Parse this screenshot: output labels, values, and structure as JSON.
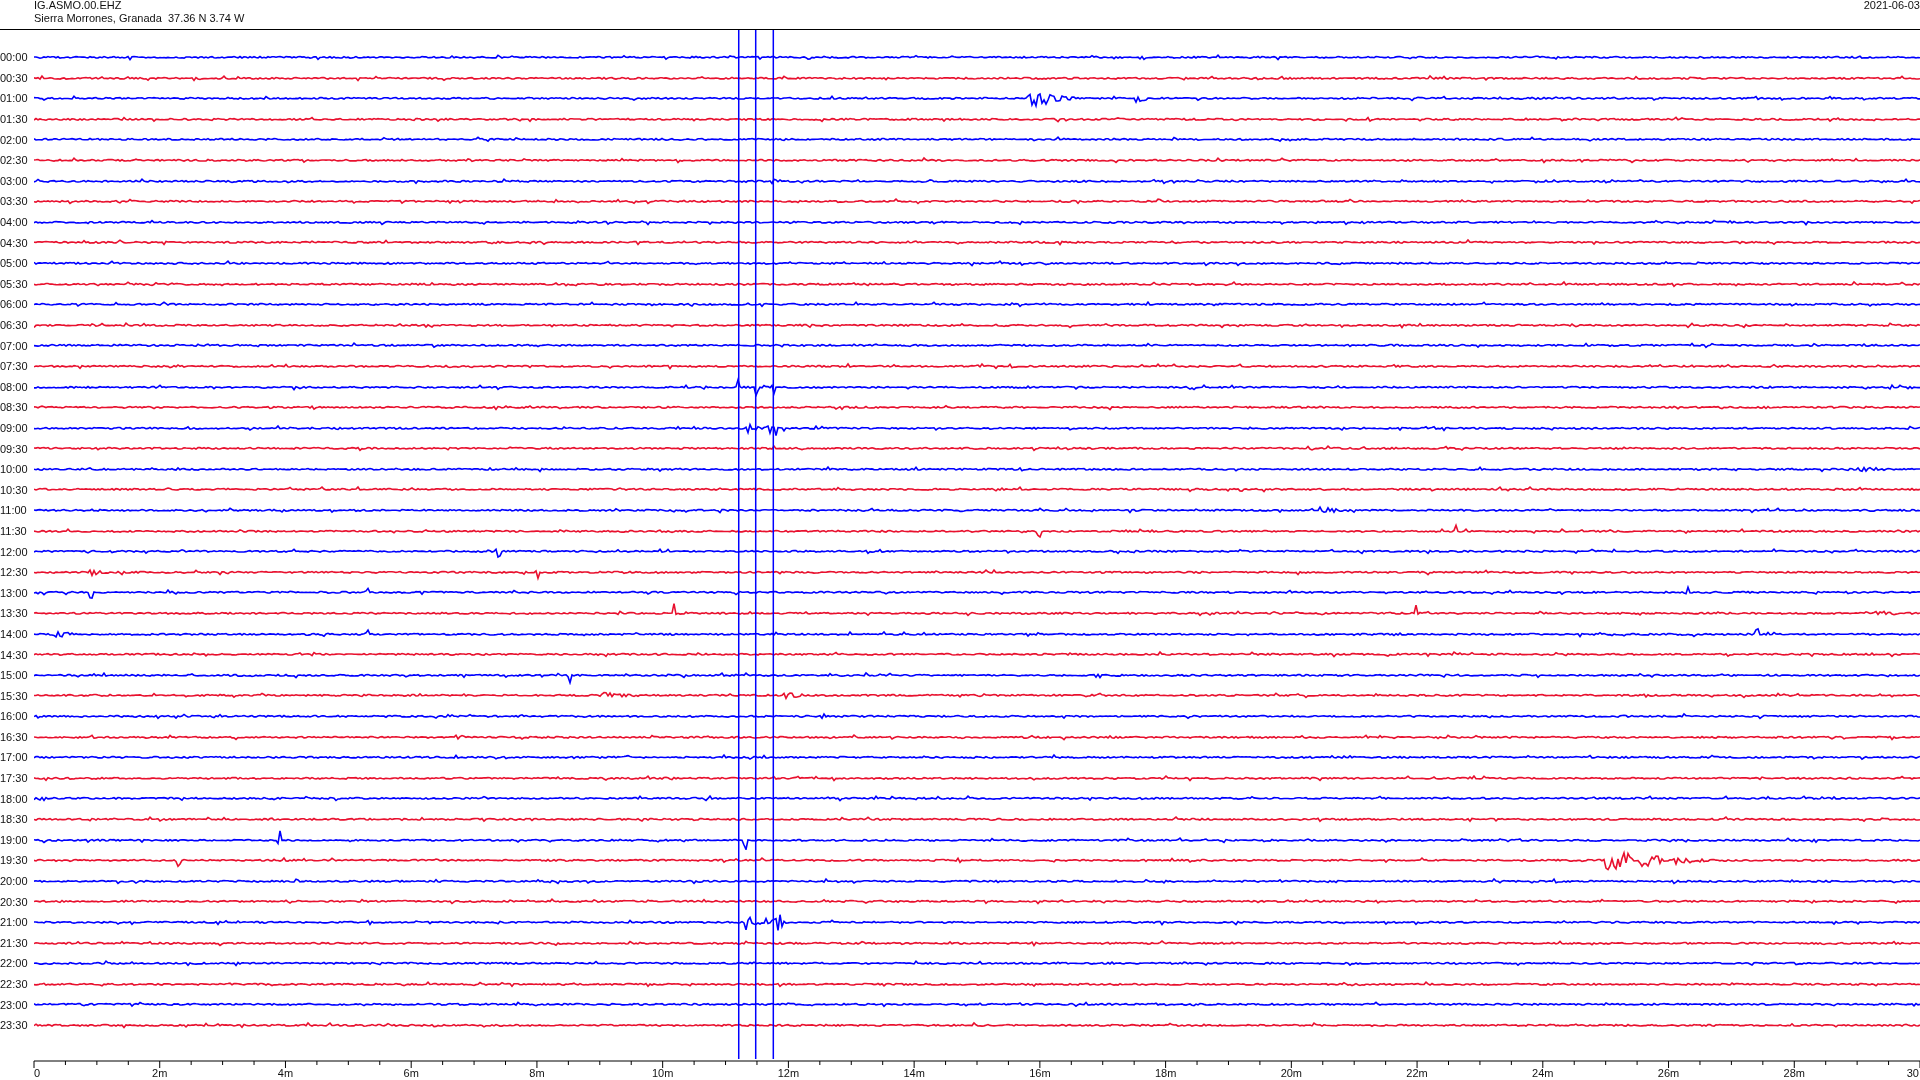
{
  "header": {
    "station": "IG.ASMO.00.EHZ",
    "location": "Sierra Morrones, Granada  37.36 N 3.74 W",
    "date": "2021-06-03"
  },
  "rows": [
    {
      "time": "00:00",
      "color": "#0000ff"
    },
    {
      "time": "00:30",
      "color": "#e8102e"
    },
    {
      "time": "01:00",
      "color": "#0000ff"
    },
    {
      "time": "01:30",
      "color": "#e8102e"
    },
    {
      "time": "02:00",
      "color": "#0000ff"
    },
    {
      "time": "02:30",
      "color": "#e8102e"
    },
    {
      "time": "03:00",
      "color": "#0000ff"
    },
    {
      "time": "03:30",
      "color": "#e8102e"
    },
    {
      "time": "04:00",
      "color": "#0000ff"
    },
    {
      "time": "04:30",
      "color": "#e8102e"
    },
    {
      "time": "05:00",
      "color": "#0000ff"
    },
    {
      "time": "05:30",
      "color": "#e8102e"
    },
    {
      "time": "06:00",
      "color": "#0000ff"
    },
    {
      "time": "06:30",
      "color": "#e8102e"
    },
    {
      "time": "07:00",
      "color": "#0000ff"
    },
    {
      "time": "07:30",
      "color": "#e8102e"
    },
    {
      "time": "08:00",
      "color": "#0000ff"
    },
    {
      "time": "08:30",
      "color": "#e8102e"
    },
    {
      "time": "09:00",
      "color": "#0000ff"
    },
    {
      "time": "09:30",
      "color": "#e8102e"
    },
    {
      "time": "10:00",
      "color": "#0000ff"
    },
    {
      "time": "10:30",
      "color": "#e8102e"
    },
    {
      "time": "11:00",
      "color": "#0000ff"
    },
    {
      "time": "11:30",
      "color": "#e8102e"
    },
    {
      "time": "12:00",
      "color": "#0000ff"
    },
    {
      "time": "12:30",
      "color": "#e8102e"
    },
    {
      "time": "13:00",
      "color": "#0000ff"
    },
    {
      "time": "13:30",
      "color": "#e8102e"
    },
    {
      "time": "14:00",
      "color": "#0000ff"
    },
    {
      "time": "14:30",
      "color": "#e8102e"
    },
    {
      "time": "15:00",
      "color": "#0000ff"
    },
    {
      "time": "15:30",
      "color": "#e8102e"
    },
    {
      "time": "16:00",
      "color": "#0000ff"
    },
    {
      "time": "16:30",
      "color": "#e8102e"
    },
    {
      "time": "17:00",
      "color": "#0000ff"
    },
    {
      "time": "17:30",
      "color": "#e8102e"
    },
    {
      "time": "18:00",
      "color": "#0000ff"
    },
    {
      "time": "18:30",
      "color": "#e8102e"
    },
    {
      "time": "19:00",
      "color": "#0000ff"
    },
    {
      "time": "19:30",
      "color": "#e8102e"
    },
    {
      "time": "20:00",
      "color": "#0000ff"
    },
    {
      "time": "20:30",
      "color": "#e8102e"
    },
    {
      "time": "21:00",
      "color": "#0000ff"
    },
    {
      "time": "21:30",
      "color": "#e8102e"
    },
    {
      "time": "22:00",
      "color": "#0000ff"
    },
    {
      "time": "22:30",
      "color": "#e8102e"
    },
    {
      "time": "23:00",
      "color": "#0000ff"
    },
    {
      "time": "23:30",
      "color": "#e8102e"
    }
  ],
  "axis_labels": [
    "0",
    "2m",
    "4m",
    "6m",
    "8m",
    "10m",
    "12m",
    "14m",
    "16m",
    "18m",
    "20m",
    "22m",
    "24m",
    "26m",
    "28m",
    "30"
  ]
}
